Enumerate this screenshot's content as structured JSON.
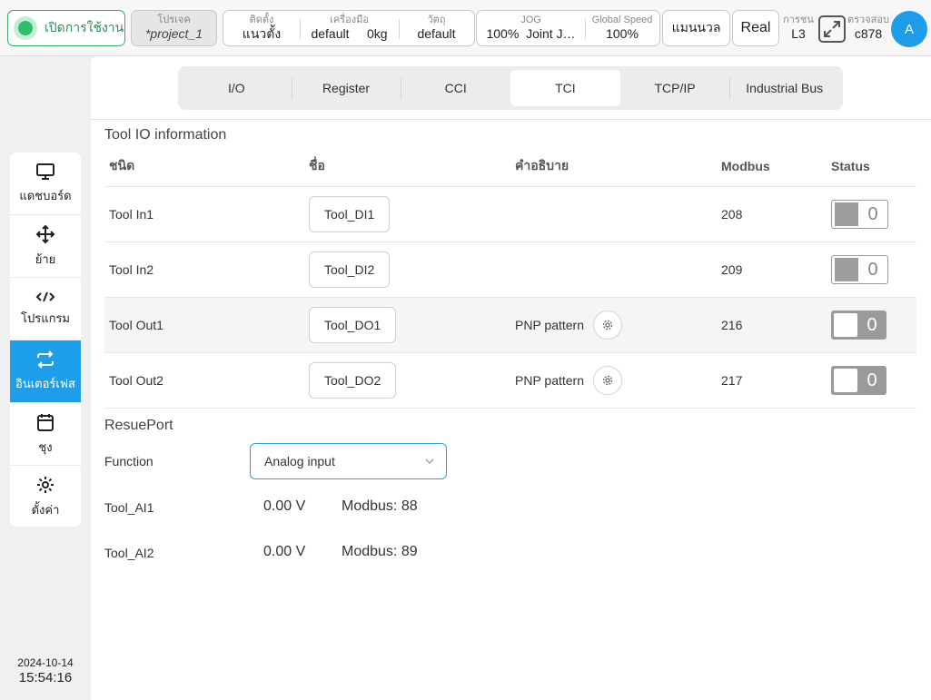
{
  "topbar": {
    "power_label": "เปิดการใช้งาน",
    "project": {
      "label": "โปรเจค",
      "value": "*project_1"
    },
    "mount": {
      "label": "ติดตั้ง",
      "value": "แนวตั้ง"
    },
    "tool": {
      "label": "เครื่องมือ",
      "value": "default",
      "weight": "0kg"
    },
    "payload": {
      "label": "วัตถุ",
      "value": "default"
    },
    "jog": {
      "label": "JOG",
      "speed": "100%",
      "mode": "Joint J…"
    },
    "global_speed": {
      "label": "Global Speed",
      "value": "100%"
    },
    "mode_button": "แมนนวล",
    "real_button": "Real",
    "collision": {
      "label": "การชน",
      "value": "L3"
    },
    "check": {
      "label": "ตรวจสอบ",
      "value": "c878"
    },
    "avatar": "A"
  },
  "sidebar": {
    "items": [
      {
        "label": "แดชบอร์ด",
        "icon": "monitor-icon"
      },
      {
        "label": "ย้าย",
        "icon": "move-icon"
      },
      {
        "label": "โปรแกรม",
        "icon": "code-icon"
      },
      {
        "label": "อินเตอร์เฟส",
        "icon": "interface-icon",
        "active": true
      },
      {
        "label": "ชุง",
        "icon": "calendar-icon"
      },
      {
        "label": "ตั้งค่า",
        "icon": "gear-icon"
      }
    ],
    "date": "2024-10-14",
    "time": "15:54:16"
  },
  "tabs": [
    "I/O",
    "Register",
    "CCI",
    "TCI",
    "TCP/IP",
    "Industrial Bus"
  ],
  "active_tab": "TCI",
  "tool_io": {
    "title": "Tool IO information",
    "headers": {
      "type": "ชนิด",
      "name": "ชื่อ",
      "description": "คำอธิบาย",
      "modbus": "Modbus",
      "status": "Status"
    },
    "rows": [
      {
        "type": "Tool In1",
        "name": "Tool_DI1",
        "description": "",
        "modbus": "208",
        "status": "0"
      },
      {
        "type": "Tool In2",
        "name": "Tool_DI2",
        "description": "",
        "modbus": "209",
        "status": "0"
      },
      {
        "type": "Tool Out1",
        "name": "Tool_DO1",
        "description": "PNP pattern",
        "modbus": "216",
        "status": "0"
      },
      {
        "type": "Tool Out2",
        "name": "Tool_DO2",
        "description": "PNP pattern",
        "modbus": "217",
        "status": "0"
      }
    ]
  },
  "reuse_port": {
    "title": "ResuePort",
    "function_label": "Function",
    "function_value": "Analog input",
    "inputs": [
      {
        "name": "Tool_AI1",
        "value": "0.00 V",
        "modbus": "Modbus: 88"
      },
      {
        "name": "Tool_AI2",
        "value": "0.00 V",
        "modbus": "Modbus: 89"
      }
    ]
  },
  "colors": {
    "accent": "#1e9ee8",
    "power_green": "#2fbf6a",
    "select_border": "#2b9fd7"
  }
}
